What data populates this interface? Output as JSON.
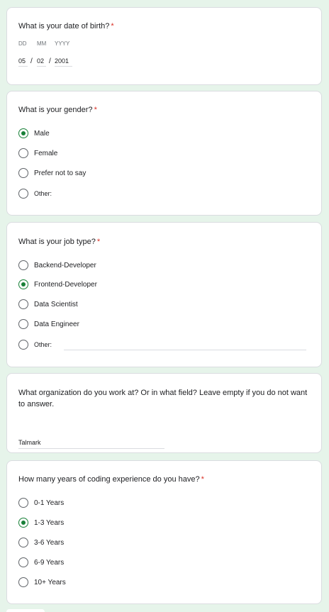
{
  "required_marker": "*",
  "dob": {
    "title": "What is your date of birth?",
    "dd_label": "DD",
    "mm_label": "MM",
    "yyyy_label": "YYYY",
    "dd_value": "05",
    "mm_value": "02",
    "yyyy_value": "2001",
    "separator": "/"
  },
  "gender": {
    "title": "What is your gender?",
    "options": [
      "Male",
      "Female",
      "Prefer not to say",
      "Other:"
    ],
    "selected": "Male"
  },
  "job": {
    "title": "What is your job type?",
    "options": [
      "Backend-Developer",
      "Frontend-Developer",
      "Data Scientist",
      "Data Engineer",
      "Other:"
    ],
    "selected": "Frontend-Developer"
  },
  "organization": {
    "title": "What organization do you work at? Or in what field? Leave empty if you do not want to answer.",
    "value": "Talmark"
  },
  "experience": {
    "title": "How many years of coding experience do you have?",
    "options": [
      "0-1 Years",
      "1-3 Years",
      "3-6 Years",
      "6-9 Years",
      "10+ Years"
    ],
    "selected": "1-3 Years"
  },
  "colors": {
    "accent": "#188038",
    "required": "#d93025",
    "background": "#e6f4ea"
  }
}
